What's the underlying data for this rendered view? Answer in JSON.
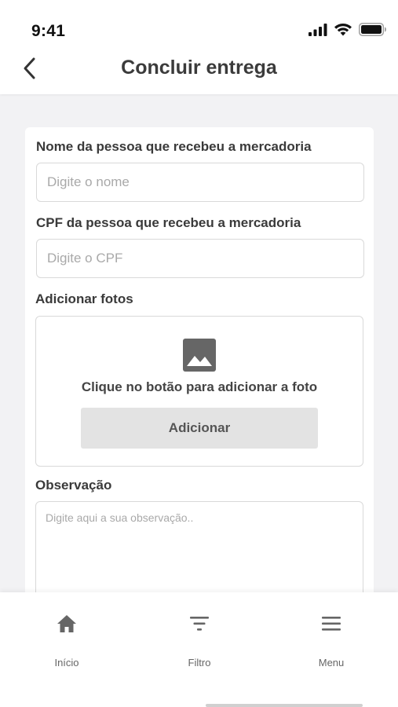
{
  "status_bar": {
    "time": "9:41"
  },
  "header": {
    "title": "Concluir entrega",
    "back_icon": "chevron-left-icon"
  },
  "form": {
    "name_label": "Nome da pessoa que recebeu a mercadoria",
    "name_placeholder": "Digite o nome",
    "name_value": "",
    "cpf_label": "CPF da pessoa que recebeu a mercadoria",
    "cpf_placeholder": "Digite o CPF",
    "cpf_value": "",
    "photos_label": "Adicionar fotos",
    "photo_icon": "image-icon",
    "photo_hint": "Clique no botão para adicionar a foto",
    "add_button_label": "Adicionar",
    "observation_label": "Observação",
    "observation_placeholder": "Digite aqui a sua observação..",
    "observation_value": ""
  },
  "bottom_nav": {
    "items": [
      {
        "label": "Início",
        "icon": "home-icon"
      },
      {
        "label": "Filtro",
        "icon": "filter-icon"
      },
      {
        "label": "Menu",
        "icon": "menu-icon"
      }
    ]
  },
  "colors": {
    "background": "#f2f2f4",
    "card": "#ffffff",
    "border": "#d9d9d9",
    "button": "#e3e3e3",
    "title_text": "#3b3b3b",
    "placeholder_text": "#a9a9a9",
    "icon": "#666666"
  }
}
